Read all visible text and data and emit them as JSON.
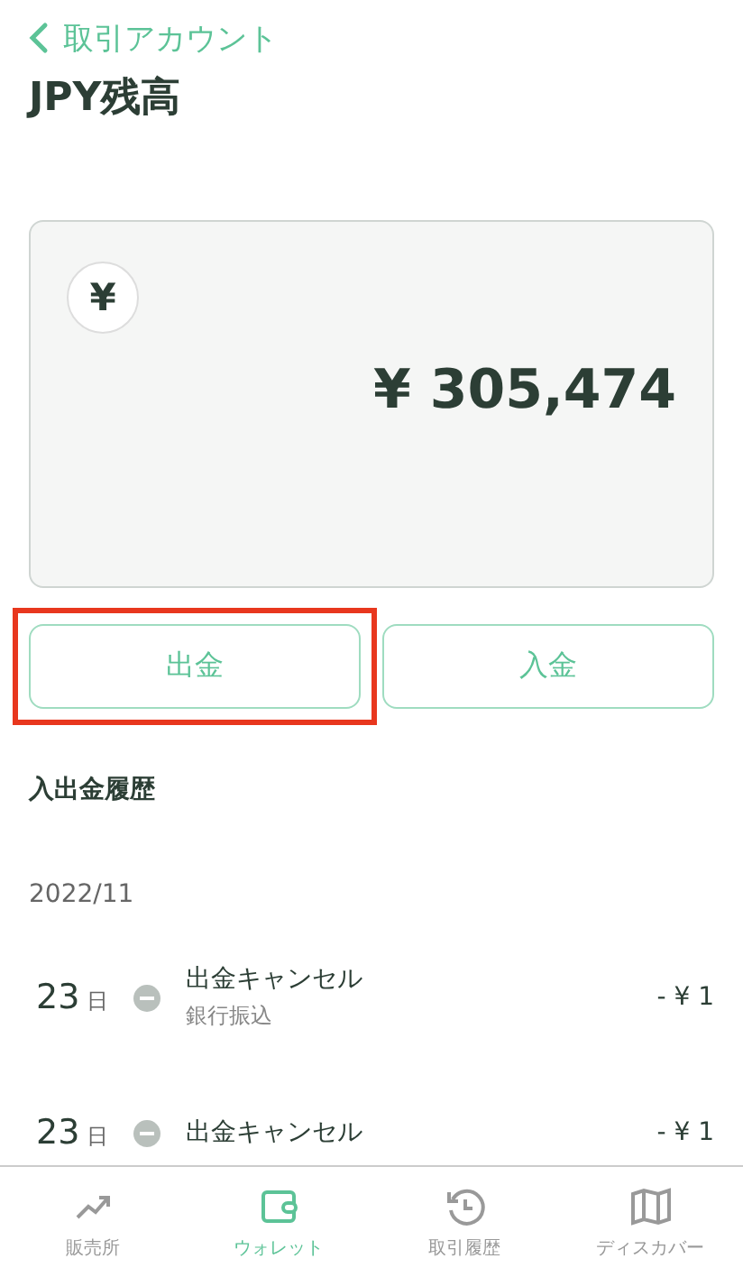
{
  "header": {
    "back_label": "取引アカウント"
  },
  "title": "JPY残高",
  "balance": {
    "currency_symbol": "¥",
    "amount": "¥ 305,474"
  },
  "actions": [
    {
      "label": "出金",
      "highlighted": true
    },
    {
      "label": "入金",
      "highlighted": false
    }
  ],
  "history": {
    "title": "入出金履歴",
    "month": "2022/11",
    "rows": [
      {
        "day": "23",
        "day_unit": "日",
        "title": "出金キャンセル",
        "subtitle": "銀行振込",
        "amount": "- ¥ 1"
      },
      {
        "day": "23",
        "day_unit": "日",
        "title": "出金キャンセル",
        "amount": "- ¥ 1"
      }
    ]
  },
  "tab_bar": [
    {
      "kind": "chart",
      "label": "販売所",
      "selected": false
    },
    {
      "kind": "wallet",
      "label": "ウォレット",
      "selected": true
    },
    {
      "kind": "history",
      "label": "取引履歴",
      "selected": false
    },
    {
      "kind": "map",
      "label": "ディスカバー",
      "selected": false
    }
  ]
}
